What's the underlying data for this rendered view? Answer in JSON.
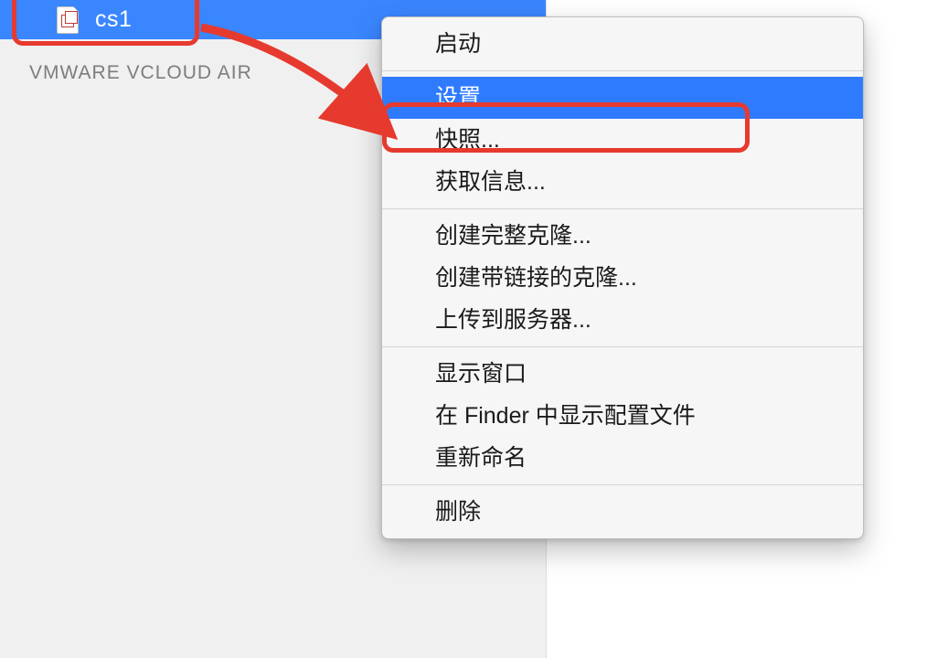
{
  "sidebar": {
    "vm": {
      "label": "cs1"
    },
    "section_header": "VMWARE VCLOUD AIR"
  },
  "context_menu": {
    "groups": [
      {
        "items": [
          {
            "label": "启动",
            "selected": false
          }
        ]
      },
      {
        "items": [
          {
            "label": "设置...",
            "selected": true
          },
          {
            "label": "快照...",
            "selected": false
          },
          {
            "label": "获取信息...",
            "selected": false
          }
        ]
      },
      {
        "items": [
          {
            "label": "创建完整克隆...",
            "selected": false
          },
          {
            "label": "创建带链接的克隆...",
            "selected": false
          },
          {
            "label": "上传到服务器...",
            "selected": false
          }
        ]
      },
      {
        "items": [
          {
            "label": "显示窗口",
            "selected": false
          },
          {
            "label": "在 Finder 中显示配置文件",
            "selected": false
          },
          {
            "label": "重新命名",
            "selected": false
          }
        ]
      },
      {
        "items": [
          {
            "label": "删除",
            "selected": false
          }
        ]
      }
    ]
  },
  "annotations": {
    "arrow_color": "#e63a2e"
  }
}
